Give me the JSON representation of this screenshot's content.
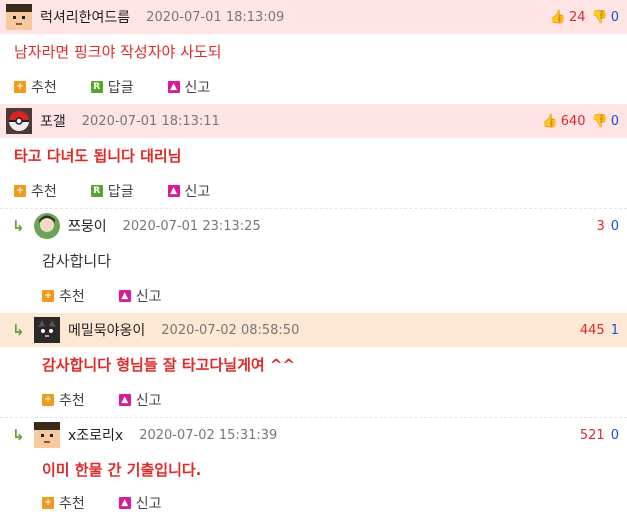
{
  "labels": {
    "recommend": "추천",
    "reply": "답글",
    "report": "신고"
  },
  "comments": [
    {
      "nick": "럭셔리한여드름",
      "date": "2020-07-01 18:13:09",
      "up": "24",
      "down": "0",
      "text": "남자라면 핑크야 작성자야 사도되"
    },
    {
      "nick": "포갤",
      "date": "2020-07-01 18:13:11",
      "up": "640",
      "down": "0",
      "text": "타고 다녀도 됩니다 대리님"
    },
    {
      "nick": "쯔뭉이",
      "date": "2020-07-01 23:13:25",
      "up": "3",
      "down": "0",
      "text": "감사합니다"
    },
    {
      "nick": "메밀묵야옹이",
      "date": "2020-07-02 08:58:50",
      "up": "445",
      "down": "1",
      "text": "감사합니다 형님들 잘 타고다닐게여 ^^"
    },
    {
      "nick": "x조로리x",
      "date": "2020-07-02 15:31:39",
      "up": "521",
      "down": "0",
      "text": "이미 한물 간 기출입니다."
    }
  ],
  "colors": {
    "accent_red": "#e02a2a",
    "accent_blue": "#1a4fd6",
    "pink_bg": "#ffe4e6",
    "peach_bg": "#fde8d4"
  }
}
